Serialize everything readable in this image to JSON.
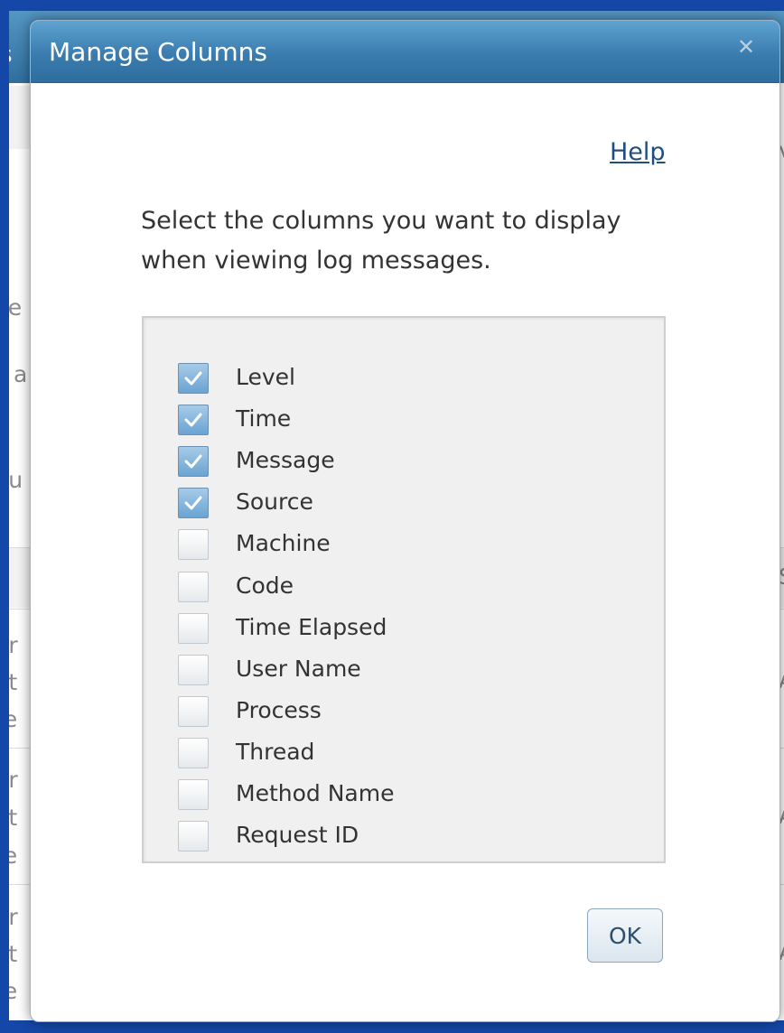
{
  "dialog": {
    "title": "Manage Columns",
    "close_glyph": "✕",
    "help_label": "Help",
    "instructions": "Select the columns you want to display when viewing log messages.",
    "ok_label": "OK"
  },
  "columns": [
    {
      "label": "Level",
      "checked": true
    },
    {
      "label": "Time",
      "checked": true
    },
    {
      "label": "Message",
      "checked": true
    },
    {
      "label": "Source",
      "checked": true
    },
    {
      "label": "Machine",
      "checked": false
    },
    {
      "label": "Code",
      "checked": false
    },
    {
      "label": "Time Elapsed",
      "checked": false
    },
    {
      "label": "User Name",
      "checked": false
    },
    {
      "label": "Process",
      "checked": false
    },
    {
      "label": "Thread",
      "checked": false
    },
    {
      "label": "Method Name",
      "checked": false
    },
    {
      "label": "Request ID",
      "checked": false
    }
  ],
  "background_fragments": {
    "tab": "s",
    "left": [
      "ve",
      "s a",
      "ou",
      "er",
      "at",
      "re",
      "er",
      "at",
      "re",
      "er",
      "at",
      "re"
    ],
    "right": [
      "v",
      "S",
      "A",
      "A",
      "A"
    ]
  },
  "colors": {
    "frame": "#1547a8",
    "header_top": "#5ea3d1",
    "header_bottom": "#2f6e9f",
    "link": "#1f4e80",
    "checkbox_checked": "#6aa3d2"
  },
  "icons": {
    "close": "close-icon",
    "check": "check-icon"
  }
}
